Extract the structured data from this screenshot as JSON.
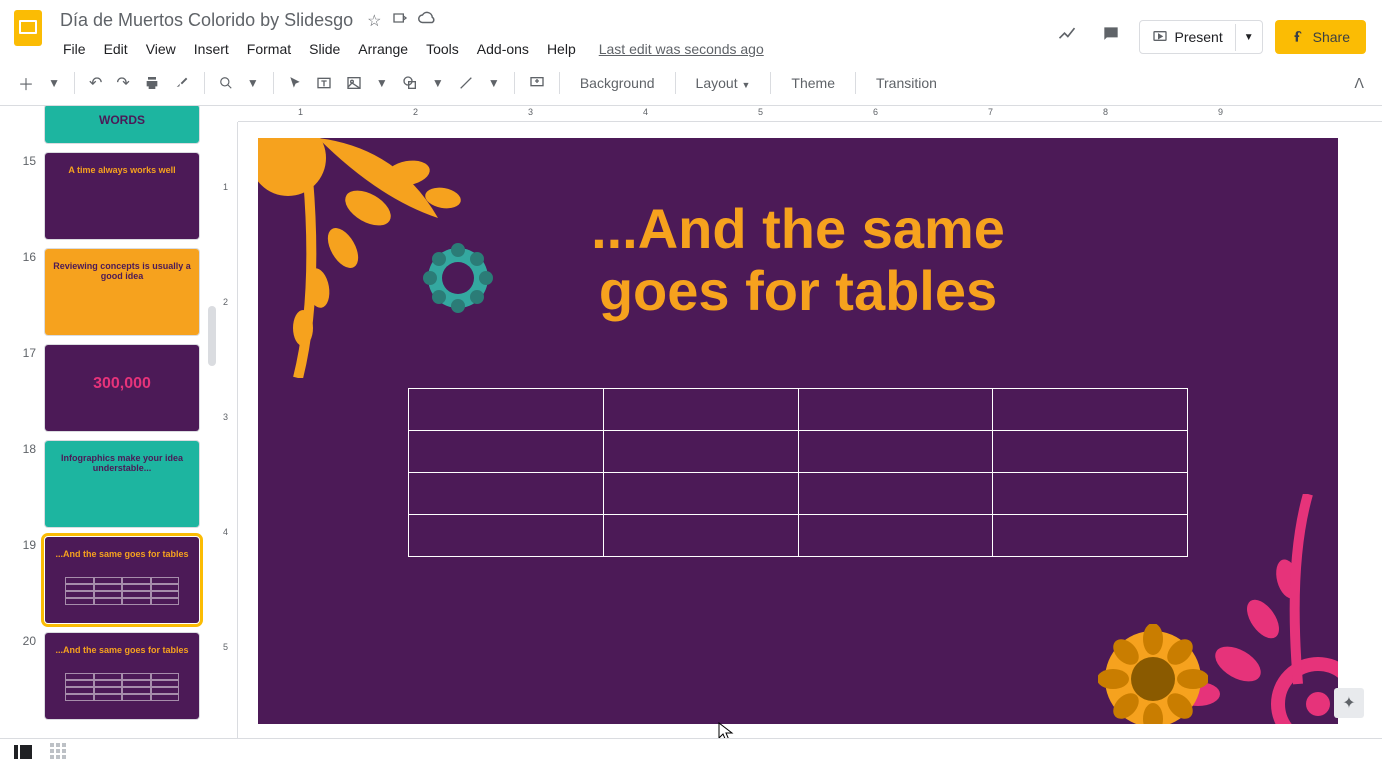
{
  "header": {
    "doc_title": "Día de Muertos Colorido by Slidesgo",
    "last_edit": "Last edit was seconds ago"
  },
  "menu": {
    "file": "File",
    "edit": "Edit",
    "view": "View",
    "insert": "Insert",
    "format": "Format",
    "slide": "Slide",
    "arrange": "Arrange",
    "tools": "Tools",
    "addons": "Add-ons",
    "help": "Help"
  },
  "buttons": {
    "present": "Present",
    "share": "Share"
  },
  "toolbar": {
    "background": "Background",
    "layout": "Layout",
    "theme": "Theme",
    "transition": "Transition"
  },
  "filmstrip": {
    "items": [
      {
        "num": "",
        "type": "teal",
        "title": "WORDS"
      },
      {
        "num": "15",
        "type": "purple",
        "title": "A time always works well"
      },
      {
        "num": "16",
        "type": "orange",
        "title": "Reviewing concepts is usually a good idea"
      },
      {
        "num": "17",
        "type": "purple",
        "title": "300,000"
      },
      {
        "num": "18",
        "type": "teal",
        "title": "Infographics make your idea understable..."
      },
      {
        "num": "19",
        "type": "purple",
        "title": "...And the same goes for tables"
      },
      {
        "num": "20",
        "type": "purple",
        "title": "...And the same goes for tables"
      }
    ],
    "selected_index": 5
  },
  "slide": {
    "title_line1": "...And the same",
    "title_line2": "goes for tables",
    "table": {
      "rows": 4,
      "cols": 4
    }
  },
  "ruler_h": [
    "1",
    "2",
    "3",
    "4",
    "5",
    "6",
    "7",
    "8",
    "9"
  ],
  "ruler_v": [
    "1",
    "2",
    "3",
    "4",
    "5"
  ]
}
